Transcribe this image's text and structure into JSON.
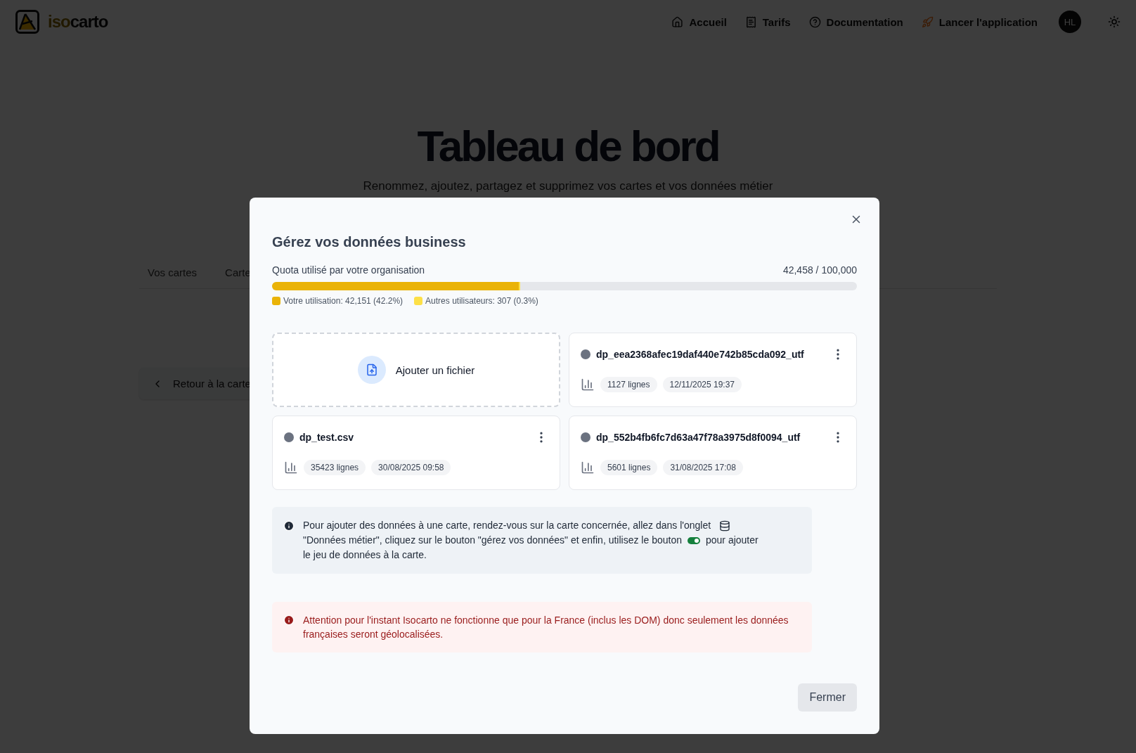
{
  "header": {
    "logo": {
      "prefix": "iso",
      "suffix": "carto"
    },
    "nav": [
      {
        "label": "Accueil"
      },
      {
        "label": "Tarifs"
      },
      {
        "label": "Documentation"
      },
      {
        "label": "Lancer l'application"
      }
    ],
    "avatar": "HL"
  },
  "page": {
    "title": "Tableau de bord",
    "subtitle": "Renommez, ajoutez, partagez et supprimez vos cartes et vos données métier",
    "tabs": [
      {
        "label": "Vos cartes",
        "selected": false
      },
      {
        "label": "Carte",
        "selected": false
      }
    ],
    "back_button": "Retour à la carte"
  },
  "dialog": {
    "title": "Gérez vos données business",
    "quota": {
      "label": "Quota utilisé par votre organisation",
      "reading": "42,458 / 100,000",
      "segments": [
        {
          "label": "Votre utilisation: 42,151 (42.2%)",
          "level": 0.4215,
          "color": "#eab308"
        },
        {
          "label": "Autres utilisateurs: 307 (0.3%)",
          "level": 0.0031,
          "color": "#fde047"
        }
      ]
    },
    "add_file": "Ajouter un fichier",
    "files": [
      {
        "name": "dp_eea2368afec19daf440e742b85cda092_utf",
        "rows": "1127 lignes",
        "date": "12/11/2025 19:37"
      },
      {
        "name": "dp_test.csv",
        "rows": "35423 lignes",
        "date": "30/08/2025 09:58"
      },
      {
        "name": "dp_552b4fb6fc7d63a47f78a3975d8f0094_utf",
        "rows": "5601 lignes",
        "date": "31/08/2025 17:08"
      }
    ],
    "info": [
      [
        {
          "kind": "text",
          "text": "Pour ajouter des données à une carte, rendez-vous sur la carte concernée, allez dans l'onglet"
        },
        {
          "kind": "database"
        }
      ],
      [
        {
          "kind": "text",
          "text": "\"Données métier\", cliquez sur le bouton \"gérez vos données\" et enfin, utilisez le bouton"
        },
        {
          "kind": "toggle"
        },
        {
          "kind": "text",
          "text": "pour ajouter"
        }
      ],
      [
        {
          "kind": "text",
          "text": "le jeu de données à la carte."
        }
      ]
    ],
    "warning": "Attention pour l'instant Isocarto ne fonctionne que pour la France (inclus les DOM) donc seulement les données françaises seront géolocalisées.",
    "close_button": "Fermer"
  }
}
